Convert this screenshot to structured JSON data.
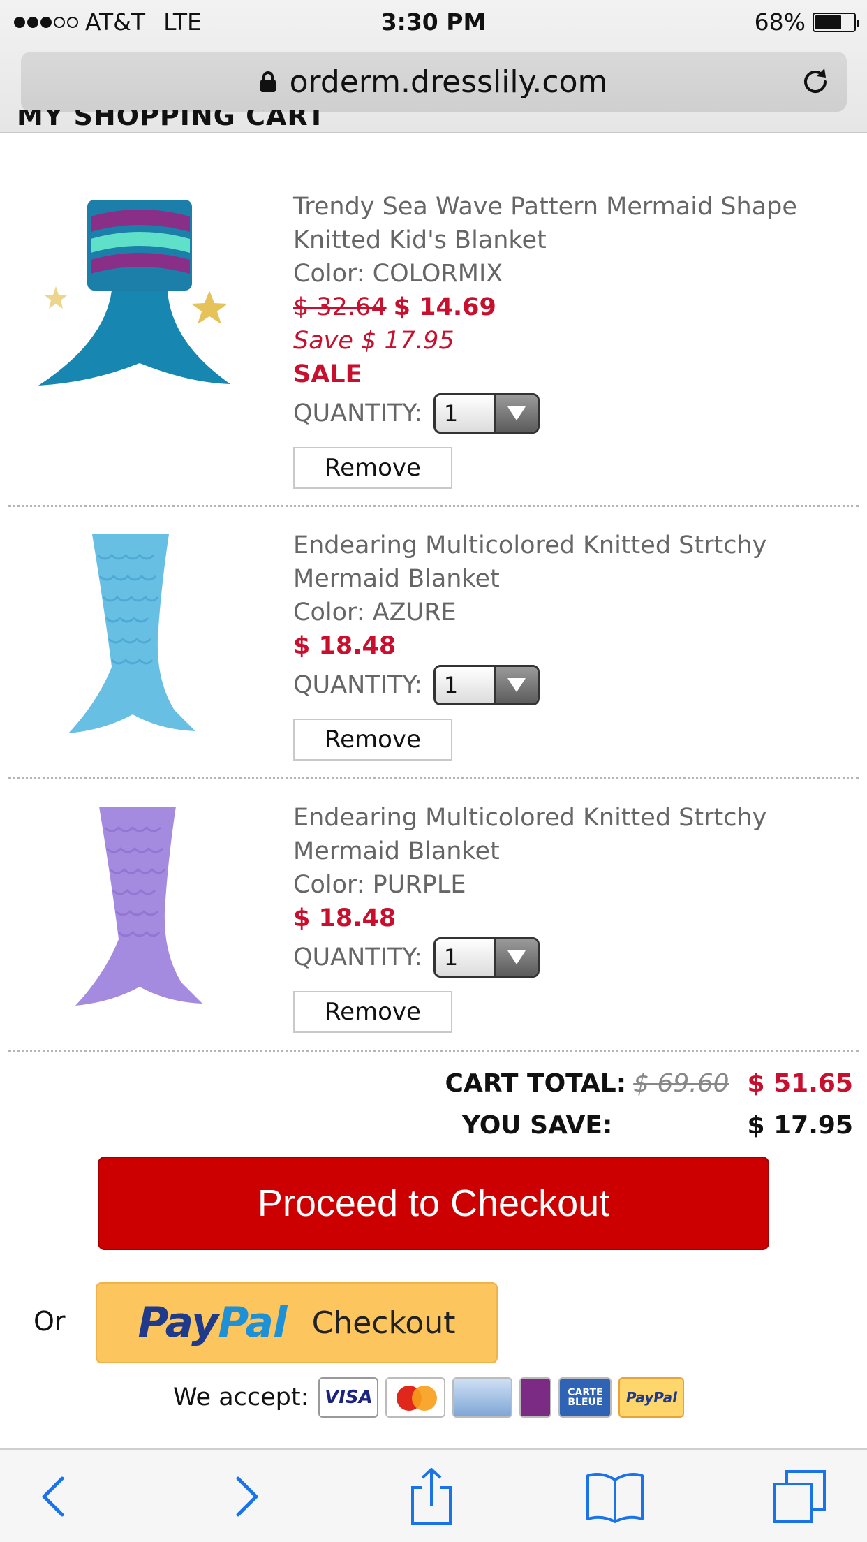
{
  "status_bar": {
    "carrier": "AT&T",
    "network": "LTE",
    "time": "3:30 PM",
    "battery_text": "68%",
    "battery_level": 0.68,
    "signal_bars_filled": 3,
    "signal_bars_total": 5
  },
  "browser": {
    "url": "orderm.dresslily.com"
  },
  "page": {
    "cut_heading": "MY SHOPPING CART"
  },
  "cart": {
    "items": [
      {
        "title_line1": "Trendy Sea Wave Pattern Mermaid Shape",
        "title_line2": "Knitted Kid's Blanket",
        "color_text": "Color: COLORMIX",
        "original_price": "$ 32.64",
        "price": "$ 14.69",
        "save_text": "Save  $ 17.95",
        "sale_label": "SALE",
        "quantity_label": "QUANTITY:",
        "quantity_value": "1",
        "remove_label": "Remove"
      },
      {
        "title_line1": "Endearing Multicolored Knitted Strtchy",
        "title_line2": "Mermaid Blanket",
        "color_text": "Color: AZURE",
        "price": "$ 18.48",
        "quantity_label": "QUANTITY:",
        "quantity_value": "1",
        "remove_label": "Remove"
      },
      {
        "title_line1": "Endearing Multicolored Knitted Strtchy",
        "title_line2": "Mermaid Blanket",
        "color_text": "Color: PURPLE",
        "price": "$ 18.48",
        "quantity_label": "QUANTITY:",
        "quantity_value": "1",
        "remove_label": "Remove"
      }
    ],
    "totals": {
      "cart_total_label": "CART TOTAL:",
      "cart_total_original": "$ 69.60",
      "cart_total_value": "$ 51.65",
      "you_save_label": "YOU SAVE:",
      "you_save_value": "$ 17.95"
    },
    "checkout_label": "Proceed to Checkout",
    "or_label": "Or",
    "paypal": {
      "logo_pay": "Pay",
      "logo_pal": "Pal",
      "checkout_label": "Checkout"
    },
    "we_accept_label": "We accept:",
    "cards": [
      {
        "name": "visa",
        "text": "VISA"
      },
      {
        "name": "mastercard",
        "text": ""
      },
      {
        "name": "amex",
        "text": ""
      },
      {
        "name": "maestro",
        "text": ""
      },
      {
        "name": "carte-bleue",
        "text": "CARTE BLEUE"
      },
      {
        "name": "paypal",
        "text": "PayPal"
      }
    ]
  },
  "colors": {
    "accent_red": "#cc0000",
    "price_red": "#c8102e",
    "paypal_yellow": "#fcc55d",
    "ios_blue": "#1a73e8"
  },
  "toolbar": {
    "icons": [
      "back-icon",
      "forward-icon",
      "share-icon",
      "bookmarks-icon",
      "tabs-icon"
    ]
  }
}
